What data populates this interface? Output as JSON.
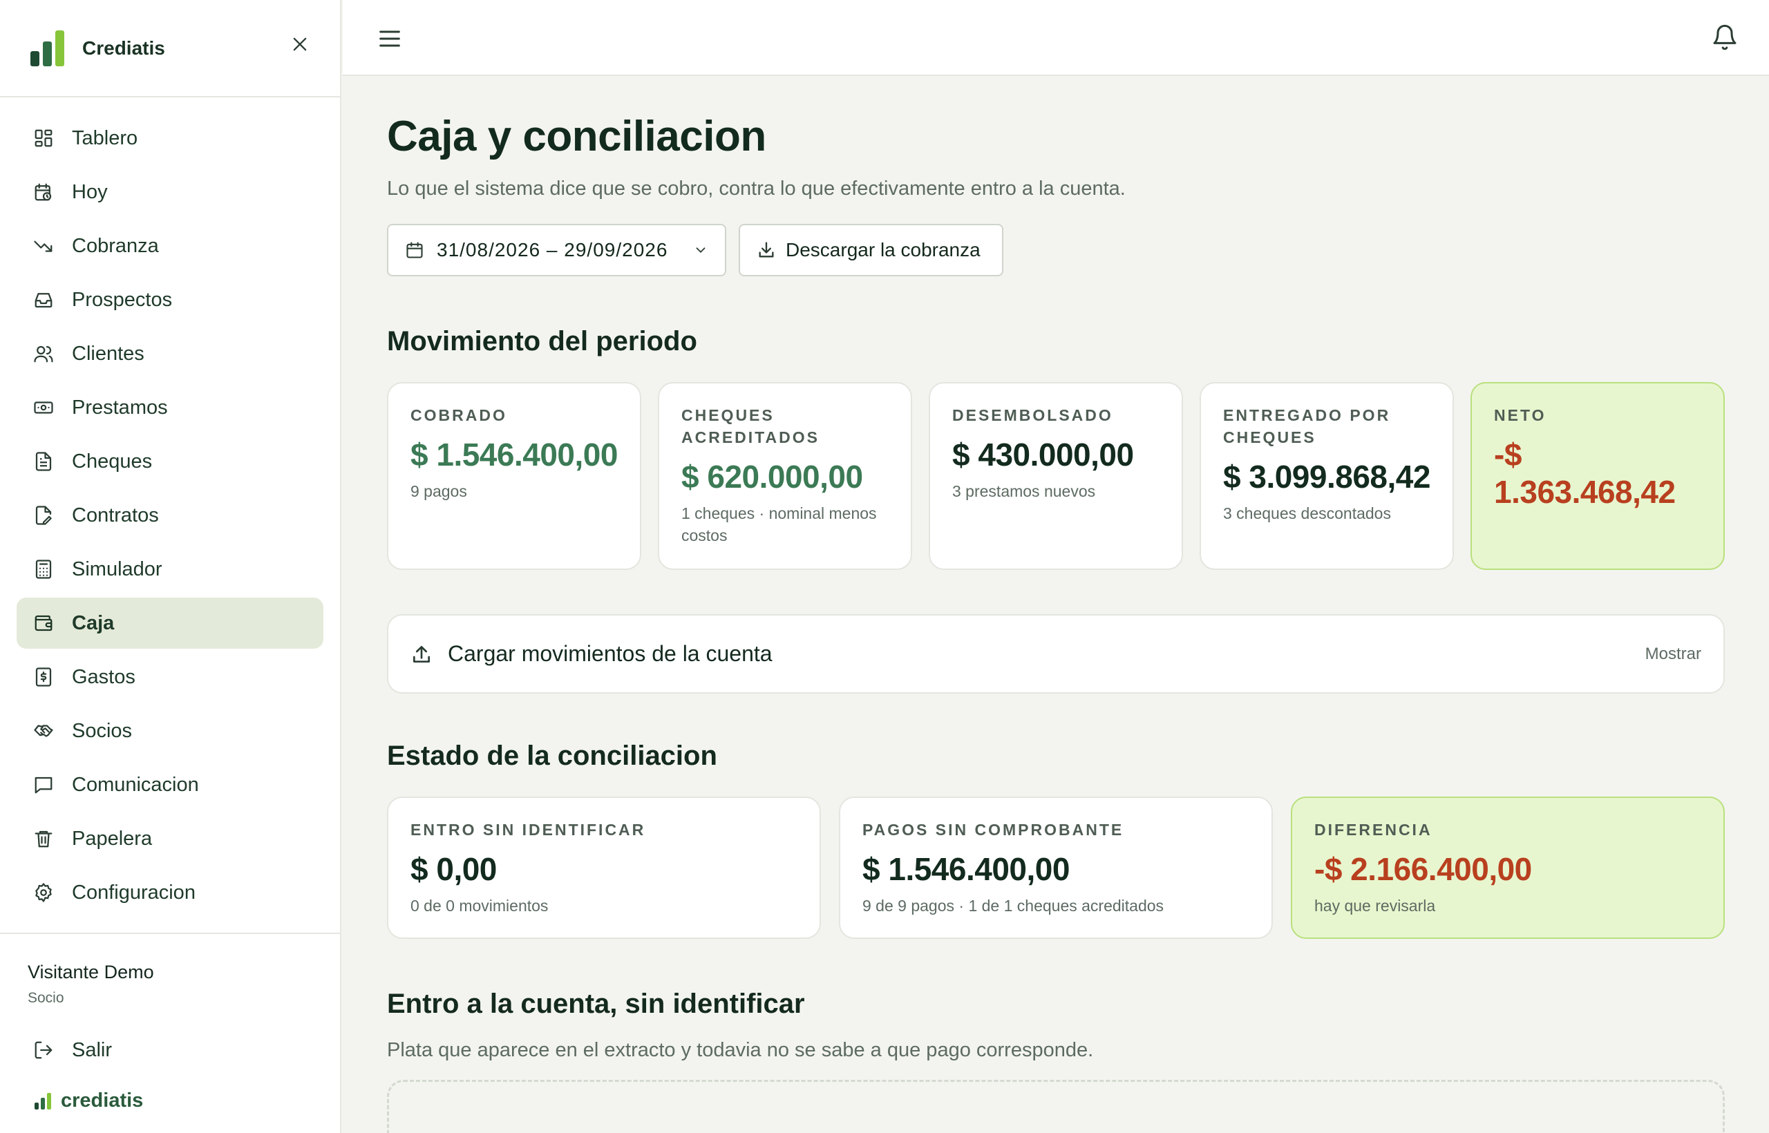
{
  "app": {
    "brand": "Crediatis",
    "footer_brand": "crediatis"
  },
  "colors": {
    "accent_green": "#3b7a55",
    "negative_red": "#b8401f",
    "highlight_bg": "#e8f6cf",
    "active_nav_bg": "#e4ead9"
  },
  "sidebar": {
    "items": [
      {
        "label": "Tablero",
        "icon": "dashboard-icon"
      },
      {
        "label": "Hoy",
        "icon": "calendar-clock-icon"
      },
      {
        "label": "Cobranza",
        "icon": "trending-down-icon"
      },
      {
        "label": "Prospectos",
        "icon": "inbox-icon"
      },
      {
        "label": "Clientes",
        "icon": "users-icon"
      },
      {
        "label": "Prestamos",
        "icon": "banknote-icon"
      },
      {
        "label": "Cheques",
        "icon": "file-text-icon"
      },
      {
        "label": "Contratos",
        "icon": "file-edit-icon"
      },
      {
        "label": "Simulador",
        "icon": "calculator-icon"
      },
      {
        "label": "Caja",
        "icon": "wallet-icon",
        "active": true
      },
      {
        "label": "Gastos",
        "icon": "receipt-dollar-icon"
      },
      {
        "label": "Socios",
        "icon": "handshake-icon"
      },
      {
        "label": "Comunicacion",
        "icon": "message-icon"
      },
      {
        "label": "Papelera",
        "icon": "trash-icon"
      },
      {
        "label": "Configuracion",
        "icon": "gear-icon"
      }
    ],
    "user": {
      "name": "Visitante Demo",
      "role": "Socio"
    },
    "logout_label": "Salir"
  },
  "page": {
    "title": "Caja y conciliacion",
    "subtitle": "Lo que el sistema dice que se cobro, contra lo que efectivamente entro a la cuenta.",
    "date_range": "31/08/2026 – 29/09/2026",
    "download_label": "Descargar la cobranza"
  },
  "movimiento": {
    "title": "Movimiento del periodo",
    "cards": [
      {
        "label": "COBRADO",
        "value": "$ 1.546.400,00",
        "note": "9 pagos"
      },
      {
        "label": "CHEQUES ACREDITADOS",
        "value": "$ 620.000,00",
        "note": "1 cheques · nominal menos costos"
      },
      {
        "label": "DESEMBOLSADO",
        "value": "$ 430.000,00",
        "note": "3 prestamos nuevos"
      },
      {
        "label": "ENTREGADO POR CHEQUES",
        "value": "$ 3.099.868,42",
        "note": "3 cheques descontados"
      },
      {
        "label": "NETO",
        "value": "-$ 1.363.468,42",
        "note": ""
      }
    ]
  },
  "upload": {
    "label": "Cargar movimientos de la cuenta",
    "toggle": "Mostrar"
  },
  "conciliacion": {
    "title": "Estado de la conciliacion",
    "cards": [
      {
        "label": "ENTRO SIN IDENTIFICAR",
        "value": "$ 0,00",
        "note": "0 de 0 movimientos"
      },
      {
        "label": "PAGOS SIN COMPROBANTE",
        "value": "$ 1.546.400,00",
        "note": "9 de 9 pagos · 1 de 1 cheques acreditados"
      },
      {
        "label": "DIFERENCIA",
        "value": "-$ 2.166.400,00",
        "note": "hay que revisarla"
      }
    ]
  },
  "sin_identificar": {
    "title": "Entro a la cuenta, sin identificar",
    "subtitle": "Plata que aparece en el extracto y todavia no se sabe a que pago corresponde."
  }
}
